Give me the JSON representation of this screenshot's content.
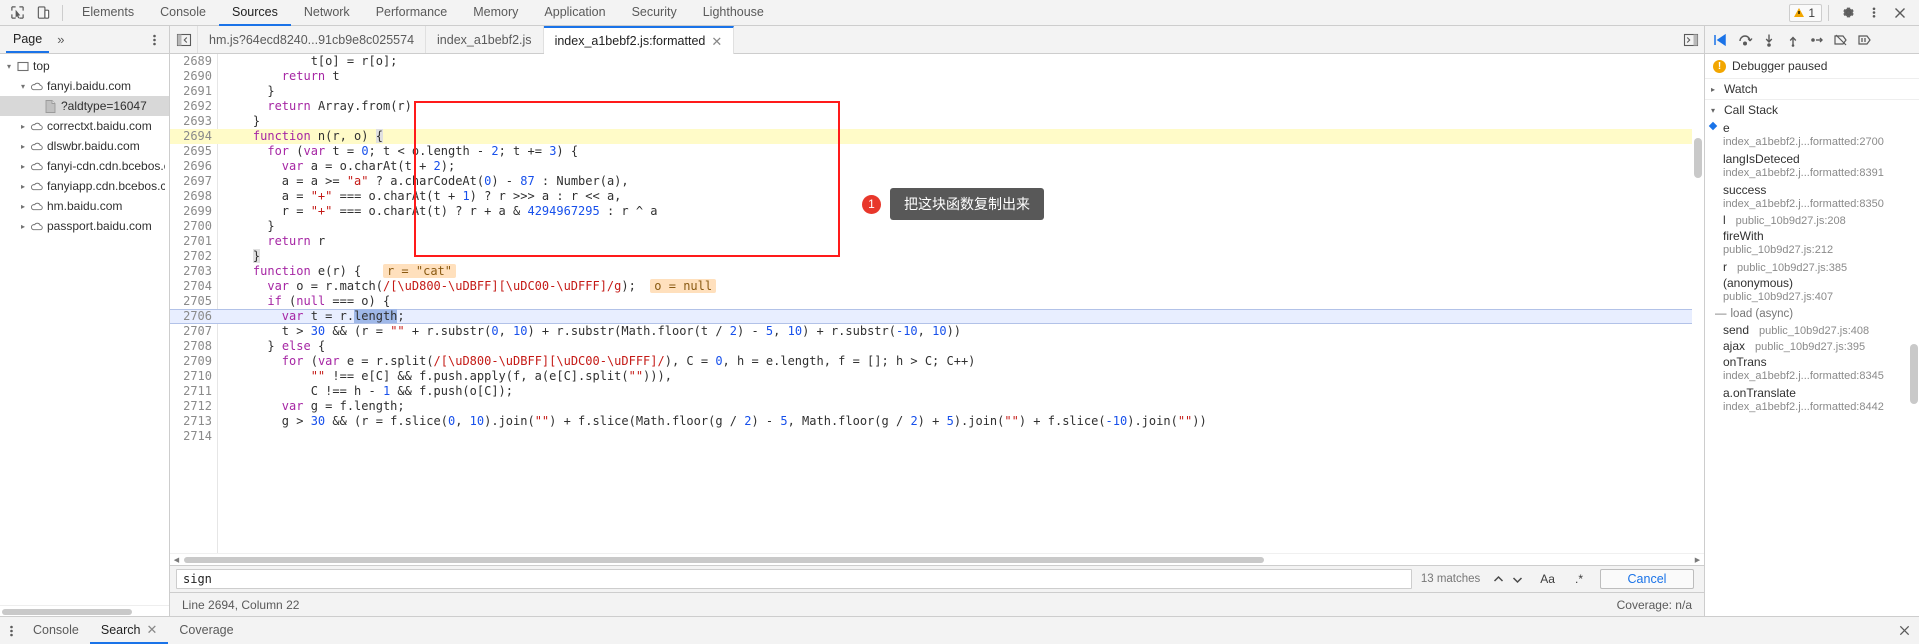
{
  "topbar": {
    "inspect_icon": "inspect-cursor-icon",
    "device_icon": "device-toolbar-icon",
    "tabs": [
      {
        "label": "Elements",
        "active": false
      },
      {
        "label": "Console",
        "active": false
      },
      {
        "label": "Sources",
        "active": true
      },
      {
        "label": "Network",
        "active": false
      },
      {
        "label": "Performance",
        "active": false
      },
      {
        "label": "Memory",
        "active": false
      },
      {
        "label": "Application",
        "active": false
      },
      {
        "label": "Security",
        "active": false
      },
      {
        "label": "Lighthouse",
        "active": false
      }
    ],
    "warning_count": "1",
    "settings_icon": "gear-icon",
    "more_icon": "vertical-dots-icon",
    "close_icon": "close-icon"
  },
  "navigator": {
    "tab_label": "Page",
    "more_label": "»",
    "menu_icon": "vertical-dots-icon",
    "tree": [
      {
        "label": "top",
        "depth": 0,
        "twisty": "open",
        "icon": "frame-icon",
        "selected": false
      },
      {
        "label": "fanyi.baidu.com",
        "depth": 1,
        "twisty": "open",
        "icon": "cloud-icon",
        "selected": false
      },
      {
        "label": "?aldtype=16047",
        "depth": 2,
        "twisty": "none",
        "icon": "document-icon",
        "selected": true
      },
      {
        "label": "correctxt.baidu.com",
        "depth": 1,
        "twisty": "closed",
        "icon": "cloud-icon",
        "selected": false
      },
      {
        "label": "dlswbr.baidu.com",
        "depth": 1,
        "twisty": "closed",
        "icon": "cloud-icon",
        "selected": false
      },
      {
        "label": "fanyi-cdn.cdn.bcebos.c",
        "depth": 1,
        "twisty": "closed",
        "icon": "cloud-icon",
        "selected": false
      },
      {
        "label": "fanyiapp.cdn.bcebos.c",
        "depth": 1,
        "twisty": "closed",
        "icon": "cloud-icon",
        "selected": false
      },
      {
        "label": "hm.baidu.com",
        "depth": 1,
        "twisty": "closed",
        "icon": "cloud-icon",
        "selected": false
      },
      {
        "label": "passport.baidu.com",
        "depth": 1,
        "twisty": "closed",
        "icon": "cloud-icon",
        "selected": false
      }
    ]
  },
  "editor_tabs": {
    "panel_toggle_icon": "show-navigator-icon",
    "tabs": [
      {
        "label": "hm.js?64ecd8240...91cb9e8c025574",
        "active": false,
        "closable": false
      },
      {
        "label": "index_a1bebf2.js",
        "active": false,
        "closable": false
      },
      {
        "label": "index_a1bebf2.js:formatted",
        "active": true,
        "closable": true
      }
    ],
    "right_button_icon": "show-debugger-sidebar-icon"
  },
  "debugger_toolbar": {
    "buttons": [
      {
        "name": "resume-script-execution-button",
        "icon": "resume-icon"
      },
      {
        "name": "step-over-next-function-call-button",
        "icon": "step-over-icon"
      },
      {
        "name": "step-into-next-function-call-button",
        "icon": "step-into-icon"
      },
      {
        "name": "step-out-of-current-function-button",
        "icon": "step-out-icon"
      },
      {
        "name": "step-button",
        "icon": "step-icon"
      },
      {
        "name": "deactivate-breakpoints-button",
        "icon": "deactivate-breakpoints-icon"
      },
      {
        "name": "pause-on-exceptions-button",
        "icon": "pause-on-exceptions-icon"
      }
    ]
  },
  "code": {
    "lines": [
      {
        "num": "2689",
        "indent": 12,
        "state": "none",
        "tokens": [
          {
            "t": "t[o] = r[o];",
            "c": "pr"
          }
        ]
      },
      {
        "num": "2690",
        "indent": 8,
        "state": "none",
        "tokens": [
          {
            "t": "return",
            "c": "kw"
          },
          {
            "t": " t",
            "c": "pr"
          }
        ]
      },
      {
        "num": "2691",
        "indent": 6,
        "state": "none",
        "tokens": [
          {
            "t": "}",
            "c": "pr"
          }
        ]
      },
      {
        "num": "2692",
        "indent": 6,
        "state": "none",
        "tokens": [
          {
            "t": "return",
            "c": "kw"
          },
          {
            "t": " Array.from(r)",
            "c": "pr"
          }
        ]
      },
      {
        "num": "2693",
        "indent": 4,
        "state": "none",
        "tokens": [
          {
            "t": "}",
            "c": "pr"
          }
        ]
      },
      {
        "num": "2694",
        "indent": 4,
        "state": "exec",
        "tokens": [
          {
            "t": "function",
            "c": "kw"
          },
          {
            "t": " n(r, o) ",
            "c": "pr"
          },
          {
            "t": "{",
            "c": "brmatch"
          }
        ]
      },
      {
        "num": "2695",
        "indent": 6,
        "state": "none",
        "tokens": [
          {
            "t": "for",
            "c": "kw"
          },
          {
            "t": " (",
            "c": "pr"
          },
          {
            "t": "var",
            "c": "kw"
          },
          {
            "t": " t = ",
            "c": "pr"
          },
          {
            "t": "0",
            "c": "num"
          },
          {
            "t": "; t < o.length - ",
            "c": "pr"
          },
          {
            "t": "2",
            "c": "num"
          },
          {
            "t": "; t += ",
            "c": "pr"
          },
          {
            "t": "3",
            "c": "num"
          },
          {
            "t": ") {",
            "c": "pr"
          }
        ]
      },
      {
        "num": "2696",
        "indent": 8,
        "state": "none",
        "tokens": [
          {
            "t": "var",
            "c": "kw"
          },
          {
            "t": " a = o.charAt(t + ",
            "c": "pr"
          },
          {
            "t": "2",
            "c": "num"
          },
          {
            "t": ");",
            "c": "pr"
          }
        ]
      },
      {
        "num": "2697",
        "indent": 8,
        "state": "none",
        "tokens": [
          {
            "t": "a = a >= ",
            "c": "pr"
          },
          {
            "t": "\"a\"",
            "c": "str"
          },
          {
            "t": " ? a.charCodeAt(",
            "c": "pr"
          },
          {
            "t": "0",
            "c": "num"
          },
          {
            "t": ") - ",
            "c": "pr"
          },
          {
            "t": "87",
            "c": "num"
          },
          {
            "t": " : Number(a),",
            "c": "pr"
          }
        ]
      },
      {
        "num": "2698",
        "indent": 8,
        "state": "none",
        "tokens": [
          {
            "t": "a = ",
            "c": "pr"
          },
          {
            "t": "\"+\"",
            "c": "str"
          },
          {
            "t": " === o.charAt(t + ",
            "c": "pr"
          },
          {
            "t": "1",
            "c": "num"
          },
          {
            "t": ") ? r >>> a : r << a,",
            "c": "pr"
          }
        ]
      },
      {
        "num": "2699",
        "indent": 8,
        "state": "none",
        "tokens": [
          {
            "t": "r = ",
            "c": "pr"
          },
          {
            "t": "\"+\"",
            "c": "str"
          },
          {
            "t": " === o.charAt(t) ? r + a & ",
            "c": "pr"
          },
          {
            "t": "4294967295",
            "c": "num"
          },
          {
            "t": " : r ^ a",
            "c": "pr"
          }
        ]
      },
      {
        "num": "2700",
        "indent": 6,
        "state": "none",
        "tokens": [
          {
            "t": "}",
            "c": "pr"
          }
        ]
      },
      {
        "num": "2701",
        "indent": 6,
        "state": "none",
        "tokens": [
          {
            "t": "return",
            "c": "kw"
          },
          {
            "t": " r",
            "c": "pr"
          }
        ]
      },
      {
        "num": "2702",
        "indent": 4,
        "state": "none",
        "tokens": [
          {
            "t": "}",
            "c": "brmatch"
          }
        ]
      },
      {
        "num": "2703",
        "indent": 4,
        "state": "none",
        "tokens": [
          {
            "t": "function",
            "c": "kw"
          },
          {
            "t": " e(r) {",
            "c": "pr"
          },
          {
            "t": "   ",
            "c": "pr"
          },
          {
            "t": "r = \"cat\"",
            "c": "vhint"
          }
        ]
      },
      {
        "num": "2704",
        "indent": 6,
        "state": "none",
        "tokens": [
          {
            "t": "var",
            "c": "kw"
          },
          {
            "t": " o = r.match(",
            "c": "pr"
          },
          {
            "t": "/[\\uD800-\\uDBFF][\\uDC00-\\uDFFF]/g",
            "c": "str"
          },
          {
            "t": ");",
            "c": "pr"
          },
          {
            "t": "  ",
            "c": "pr"
          },
          {
            "t": "o = null",
            "c": "vhint"
          }
        ]
      },
      {
        "num": "2705",
        "indent": 6,
        "state": "none",
        "tokens": [
          {
            "t": "if",
            "c": "kw"
          },
          {
            "t": " (",
            "c": "pr"
          },
          {
            "t": "null",
            "c": "kw"
          },
          {
            "t": " === o) {",
            "c": "pr"
          }
        ]
      },
      {
        "num": "2706",
        "indent": 8,
        "state": "sel",
        "tokens": [
          {
            "t": "var",
            "c": "kw"
          },
          {
            "t": " t = r.",
            "c": "pr"
          },
          {
            "t": "length",
            "c": "sel-tok"
          },
          {
            "t": ";",
            "c": "pr"
          }
        ]
      },
      {
        "num": "2707",
        "indent": 8,
        "state": "none",
        "tokens": [
          {
            "t": "t > ",
            "c": "pr"
          },
          {
            "t": "30",
            "c": "num"
          },
          {
            "t": " && (r = ",
            "c": "pr"
          },
          {
            "t": "\"\"",
            "c": "str"
          },
          {
            "t": " + r.substr(",
            "c": "pr"
          },
          {
            "t": "0",
            "c": "num"
          },
          {
            "t": ", ",
            "c": "pr"
          },
          {
            "t": "10",
            "c": "num"
          },
          {
            "t": ") + r.substr(Math.floor(t / ",
            "c": "pr"
          },
          {
            "t": "2",
            "c": "num"
          },
          {
            "t": ") - ",
            "c": "pr"
          },
          {
            "t": "5",
            "c": "num"
          },
          {
            "t": ", ",
            "c": "pr"
          },
          {
            "t": "10",
            "c": "num"
          },
          {
            "t": ") + r.substr(",
            "c": "pr"
          },
          {
            "t": "-10",
            "c": "num"
          },
          {
            "t": ", ",
            "c": "pr"
          },
          {
            "t": "10",
            "c": "num"
          },
          {
            "t": "))",
            "c": "pr"
          }
        ]
      },
      {
        "num": "2708",
        "indent": 6,
        "state": "none",
        "tokens": [
          {
            "t": "} ",
            "c": "pr"
          },
          {
            "t": "else",
            "c": "kw"
          },
          {
            "t": " {",
            "c": "pr"
          }
        ]
      },
      {
        "num": "2709",
        "indent": 8,
        "state": "none",
        "tokens": [
          {
            "t": "for",
            "c": "kw"
          },
          {
            "t": " (",
            "c": "pr"
          },
          {
            "t": "var",
            "c": "kw"
          },
          {
            "t": " e = r.split(",
            "c": "pr"
          },
          {
            "t": "/[\\uD800-\\uDBFF][\\uDC00-\\uDFFF]/",
            "c": "str"
          },
          {
            "t": "), C = ",
            "c": "pr"
          },
          {
            "t": "0",
            "c": "num"
          },
          {
            "t": ", h = e.length, f = []; h > C; C++)",
            "c": "pr"
          }
        ]
      },
      {
        "num": "2710",
        "indent": 12,
        "state": "none",
        "tokens": [
          {
            "t": "\"\"",
            "c": "str"
          },
          {
            "t": " !== e[C] && f.push.apply(f, a(e[C].split(",
            "c": "pr"
          },
          {
            "t": "\"\"",
            "c": "str"
          },
          {
            "t": "))),",
            "c": "pr"
          }
        ]
      },
      {
        "num": "2711",
        "indent": 12,
        "state": "none",
        "tokens": [
          {
            "t": "C !== h - ",
            "c": "pr"
          },
          {
            "t": "1",
            "c": "num"
          },
          {
            "t": " && f.push(o[C]);",
            "c": "pr"
          }
        ]
      },
      {
        "num": "2712",
        "indent": 8,
        "state": "none",
        "tokens": [
          {
            "t": "var",
            "c": "kw"
          },
          {
            "t": " g = f.length;",
            "c": "pr"
          }
        ]
      },
      {
        "num": "2713",
        "indent": 8,
        "state": "none",
        "tokens": [
          {
            "t": "g > ",
            "c": "pr"
          },
          {
            "t": "30",
            "c": "num"
          },
          {
            "t": " && (r = f.slice(",
            "c": "pr"
          },
          {
            "t": "0",
            "c": "num"
          },
          {
            "t": ", ",
            "c": "pr"
          },
          {
            "t": "10",
            "c": "num"
          },
          {
            "t": ").join(",
            "c": "pr"
          },
          {
            "t": "\"\"",
            "c": "str"
          },
          {
            "t": ") + f.slice(Math.floor(g / ",
            "c": "pr"
          },
          {
            "t": "2",
            "c": "num"
          },
          {
            "t": ") - ",
            "c": "pr"
          },
          {
            "t": "5",
            "c": "num"
          },
          {
            "t": ", Math.floor(g / ",
            "c": "pr"
          },
          {
            "t": "2",
            "c": "num"
          },
          {
            "t": ") + ",
            "c": "pr"
          },
          {
            "t": "5",
            "c": "num"
          },
          {
            "t": ").join(",
            "c": "pr"
          },
          {
            "t": "\"\"",
            "c": "str"
          },
          {
            "t": ") + f.slice(",
            "c": "pr"
          },
          {
            "t": "-10",
            "c": "num"
          },
          {
            "t": ").join(",
            "c": "pr"
          },
          {
            "t": "\"\"",
            "c": "str"
          },
          {
            "t": "))",
            "c": "pr"
          }
        ]
      },
      {
        "num": "2714",
        "indent": 6,
        "state": "none",
        "tokens": [
          {
            "t": "",
            "c": "pr"
          }
        ]
      }
    ]
  },
  "annotation": {
    "number": "1",
    "text": "把这块函数复制出来",
    "box_color": "#ff1a1a",
    "badge_color": "#e8372b"
  },
  "search": {
    "value": "sign",
    "placeholder": "Find",
    "matches_text": "13 matches",
    "prev_icon": "chevron-up-icon",
    "next_icon": "chevron-down-icon",
    "match_case_label": "Aa",
    "regex_label": ".*",
    "cancel_label": "Cancel"
  },
  "status": {
    "cursor": "Line 2694, Column 22",
    "coverage": "Coverage: n/a"
  },
  "debugger_sidebar": {
    "paused_label": "Debugger paused",
    "watch_label": "Watch",
    "call_stack_label": "Call Stack",
    "load_async_label": "load (async)",
    "frames": [
      {
        "fn": "e",
        "loc": "index_a1bebf2.j...formatted:2700",
        "current": true
      },
      {
        "fn": "langIsDeteced",
        "loc": "index_a1bebf2.j...formatted:8391",
        "current": false
      },
      {
        "fn": "success",
        "loc": "index_a1bebf2.j...formatted:8350",
        "current": false
      },
      {
        "fn": "l",
        "loc": "public_10b9d27.js:208",
        "current": false,
        "inline": true
      },
      {
        "fn": "fireWith",
        "loc": "public_10b9d27.js:212",
        "current": false
      },
      {
        "fn": "r",
        "loc": "public_10b9d27.js:385",
        "current": false,
        "inline": true
      },
      {
        "fn": "(anonymous)",
        "loc": "public_10b9d27.js:407",
        "current": false
      }
    ],
    "async_frames": [
      {
        "fn": "send",
        "loc": "public_10b9d27.js:408",
        "inline": true
      },
      {
        "fn": "ajax",
        "loc": "public_10b9d27.js:395",
        "inline": true
      },
      {
        "fn": "onTrans",
        "loc": "index_a1bebf2.j...formatted:8345",
        "inline": false
      },
      {
        "fn": "a.onTranslate",
        "loc": "index_a1bebf2.j...formatted:8442",
        "inline": false
      }
    ]
  },
  "drawer": {
    "menu_icon": "vertical-dots-icon",
    "tabs": [
      {
        "label": "Console",
        "active": false,
        "closable": false
      },
      {
        "label": "Search",
        "active": true,
        "closable": true
      },
      {
        "label": "Coverage",
        "active": false,
        "closable": false
      }
    ],
    "close_icon": "close-icon"
  }
}
